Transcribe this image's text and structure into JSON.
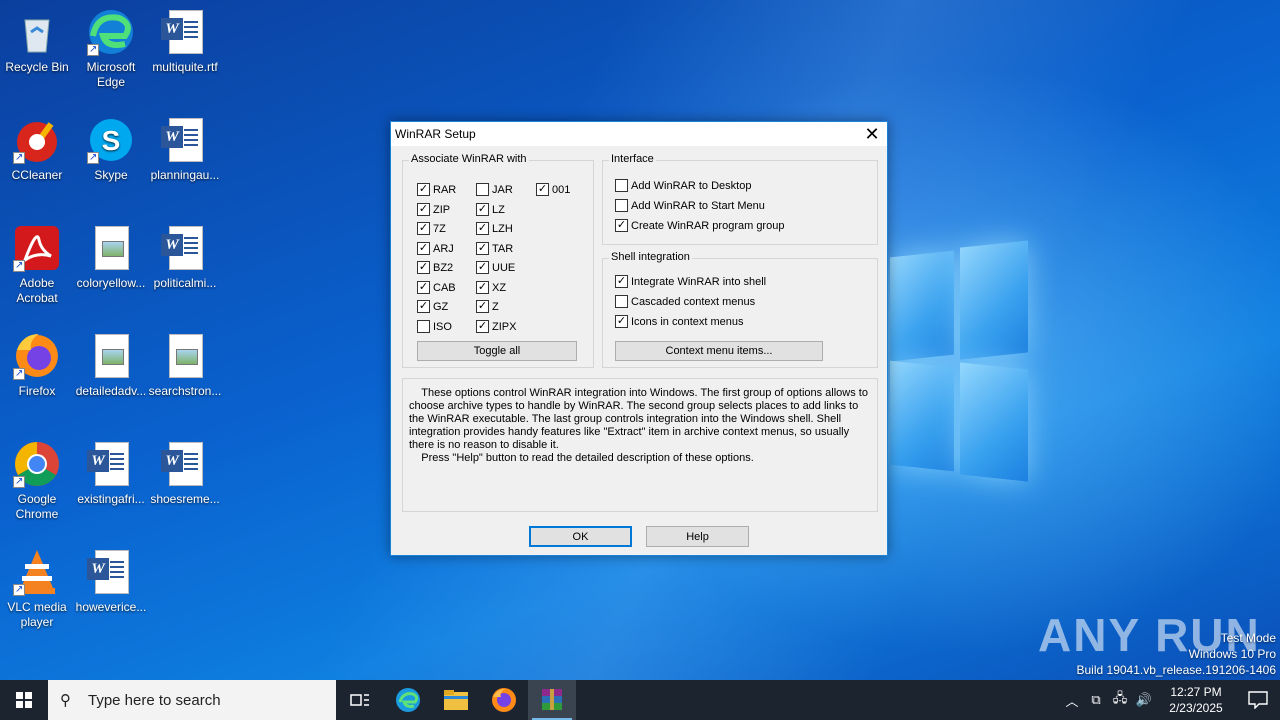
{
  "desktop": {
    "icons": [
      {
        "label": "Recycle Bin",
        "icon": "recycle-bin-icon"
      },
      {
        "label": "Microsoft Edge",
        "icon": "edge-icon"
      },
      {
        "label": "multiquite.rtf",
        "icon": "word-doc-icon"
      },
      {
        "label": "CCleaner",
        "icon": "ccleaner-icon"
      },
      {
        "label": "Skype",
        "icon": "skype-icon"
      },
      {
        "label": "planningau...",
        "icon": "word-doc-icon"
      },
      {
        "label": "Adobe Acrobat",
        "icon": "acrobat-icon"
      },
      {
        "label": "coloryellow...",
        "icon": "image-doc-icon"
      },
      {
        "label": "politicalmi...",
        "icon": "word-doc-icon"
      },
      {
        "label": "Firefox",
        "icon": "firefox-icon"
      },
      {
        "label": "detailedadv...",
        "icon": "image-doc-icon"
      },
      {
        "label": "searchstron...",
        "icon": "image-doc-icon"
      },
      {
        "label": "Google Chrome",
        "icon": "chrome-icon"
      },
      {
        "label": "existingafri...",
        "icon": "word-doc-icon"
      },
      {
        "label": "shoesreme...",
        "icon": "word-doc-icon"
      },
      {
        "label": "VLC media player",
        "icon": "vlc-icon"
      },
      {
        "label": "howeverice...",
        "icon": "word-doc-icon"
      }
    ]
  },
  "dialog": {
    "title": "WinRAR Setup",
    "associate": {
      "legend": "Associate WinRAR with",
      "items": [
        {
          "label": "RAR",
          "checked": true
        },
        {
          "label": "ZIP",
          "checked": true
        },
        {
          "label": "7Z",
          "checked": true
        },
        {
          "label": "ARJ",
          "checked": true
        },
        {
          "label": "BZ2",
          "checked": true
        },
        {
          "label": "CAB",
          "checked": true
        },
        {
          "label": "GZ",
          "checked": true
        },
        {
          "label": "ISO",
          "checked": false
        },
        {
          "label": "JAR",
          "checked": false
        },
        {
          "label": "LZ",
          "checked": true
        },
        {
          "label": "LZH",
          "checked": true
        },
        {
          "label": "TAR",
          "checked": true
        },
        {
          "label": "UUE",
          "checked": true
        },
        {
          "label": "XZ",
          "checked": true
        },
        {
          "label": "Z",
          "checked": true
        },
        {
          "label": "ZIPX",
          "checked": true
        },
        {
          "label": "001",
          "checked": true
        }
      ],
      "toggle_label": "Toggle all"
    },
    "interface": {
      "legend": "Interface",
      "items": [
        {
          "label": "Add WinRAR to Desktop",
          "checked": false
        },
        {
          "label": "Add WinRAR to Start Menu",
          "checked": false
        },
        {
          "label": "Create WinRAR program group",
          "checked": true
        }
      ]
    },
    "shell": {
      "legend": "Shell integration",
      "items": [
        {
          "label": "Integrate WinRAR into shell",
          "checked": true
        },
        {
          "label": "Cascaded context menus",
          "checked": false
        },
        {
          "label": "Icons in context menus",
          "checked": true
        }
      ],
      "context_button": "Context menu items..."
    },
    "info_text": "    These options control WinRAR integration into Windows. The first group of options allows to choose archive types to handle by WinRAR. The second group selects places to add links to the WinRAR executable. The last group controls integration into the Windows shell. Shell integration provides handy features like \"Extract\" item in archive context menus, so usually there is no reason to disable it.\n    Press \"Help\" button to read the detailed description of these options.",
    "ok_label": "OK",
    "help_label": "Help"
  },
  "watermark": "ANY RUN",
  "sysinfo": {
    "line1": "Test Mode",
    "line2": "Windows 10 Pro",
    "line3": "Build 19041.vb_release.191206-1406"
  },
  "taskbar": {
    "search_placeholder": "Type here to search",
    "pinned": [
      "task-view-icon",
      "edge-icon",
      "file-explorer-icon",
      "firefox-icon",
      "winrar-icon"
    ],
    "time": "12:27 PM",
    "date": "2/23/2025"
  }
}
